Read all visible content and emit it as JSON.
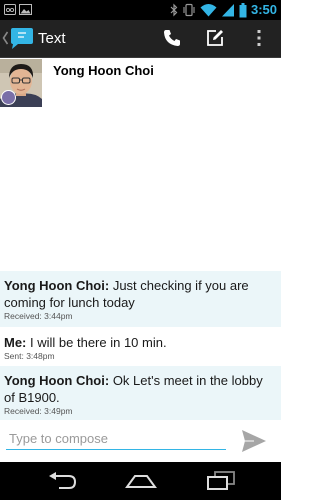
{
  "status_bar": {
    "time": "3:50",
    "icons": [
      "voicemail-icon",
      "image-icon",
      "bluetooth-icon",
      "vibrate-icon",
      "wifi-icon",
      "signal-icon",
      "battery-icon"
    ]
  },
  "action_bar": {
    "title": "Text",
    "icons": [
      "messaging-app-icon",
      "phone-icon",
      "compose-icon",
      "overflow-menu-icon"
    ],
    "accent": "#33b5e5"
  },
  "contact": {
    "name": "Yong Hoon Choi"
  },
  "messages": [
    {
      "direction": "in",
      "sender": "Yong Hoon Choi:",
      "text": "Just checking if you are coming for lunch today",
      "meta": "Received: 3:44pm"
    },
    {
      "direction": "out",
      "sender": "Me:",
      "text": "I will be there in 10 min.",
      "meta": "Sent: 3:48pm"
    },
    {
      "direction": "in",
      "sender": "Yong Hoon Choi:",
      "text": "Ok Let's meet in the lobby of B1900.",
      "meta": "Received: 3:49pm"
    }
  ],
  "compose": {
    "placeholder": "Type to compose",
    "value": ""
  },
  "nav_bar": {
    "icons": [
      "back-icon",
      "home-icon",
      "recent-apps-icon"
    ]
  }
}
